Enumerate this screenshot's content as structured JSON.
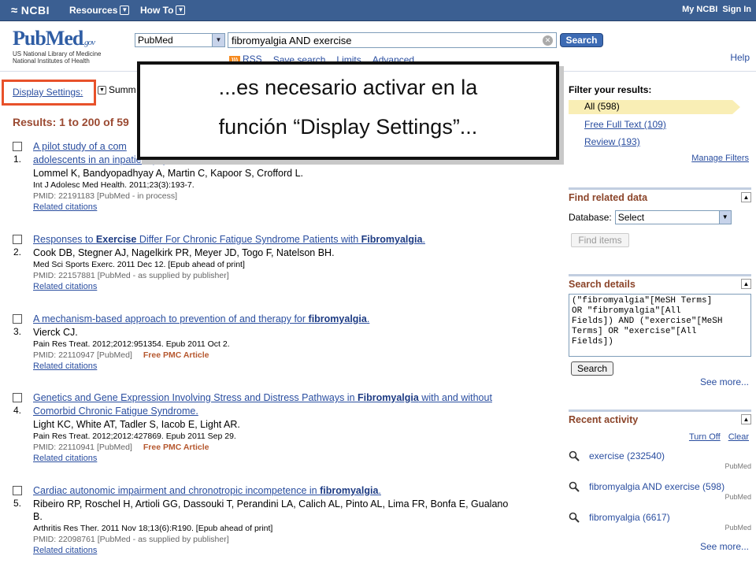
{
  "ncbi": {
    "logo": "NCBI",
    "menus": [
      "Resources",
      "How To"
    ],
    "right": [
      "My NCBI",
      "Sign In"
    ]
  },
  "header": {
    "logo_word": "PubMed",
    "logo_gov": ".gov",
    "logo_sub1": "US National Library of Medicine",
    "logo_sub2": "National Institutes of Health",
    "db_value": "PubMed",
    "search_value": "fibromyalgia AND exercise",
    "search_button": "Search",
    "links": [
      "RSS",
      "Save search",
      "Limits",
      "Advanced"
    ],
    "help": "Help"
  },
  "left": {
    "display_settings": "Display Settings:",
    "summary": "Summ",
    "results_count": "Results: 1 to 200 of 59"
  },
  "results": [
    {
      "num": "1.",
      "title_lines": [
        "A pilot study of a com",
        "adolescents in an inpatient psychiatric unit."
      ],
      "authors": "Lommel K, Bandyopadhyay A, Martin C, Kapoor S, Crofford L.",
      "journal": "Int J Adolesc Med Health. 2011;23(3):193-7.",
      "pmid": "PMID: 22191183 [PubMed - in process]",
      "pmc": "",
      "related": "Related citations"
    },
    {
      "num": "2.",
      "title_pre": "Responses to ",
      "title_b1": "Exercise",
      "title_mid": " Differ For Chronic Fatigue Syndrome Patients with ",
      "title_b2": "Fibromyalgia",
      "title_post": ".",
      "authors": "Cook DB, Stegner AJ, Nagelkirk PR, Meyer JD, Togo F, Natelson BH.",
      "journal": "Med Sci Sports Exerc. 2011 Dec 12. [Epub ahead of print]",
      "pmid": "PMID: 22157881 [PubMed - as supplied by publisher]",
      "related": "Related citations"
    },
    {
      "num": "3.",
      "title_pre": "A mechanism-based approach to prevention of and therapy for ",
      "title_b1": "fibromyalgia",
      "title_post": ".",
      "authors": "Vierck CJ.",
      "journal": "Pain Res Treat. 2012;2012:951354. Epub 2011 Oct 2.",
      "pmid": "PMID: 22110947 [PubMed]",
      "pmc": "Free PMC Article",
      "related": "Related citations"
    },
    {
      "num": "4.",
      "title_pre": "Genetics and Gene Expression Involving Stress and Distress Pathways in ",
      "title_b1": "Fibromyalgia",
      "title_mid": " with and without",
      "title_line2": "Comorbid Chronic Fatigue Syndrome.",
      "authors": "Light KC, White AT, Tadler S, Iacob E, Light AR.",
      "journal": "Pain Res Treat. 2012;2012:427869. Epub 2011 Sep 29.",
      "pmid": "PMID: 22110941 [PubMed]",
      "pmc": "Free PMC Article",
      "related": "Related citations"
    },
    {
      "num": "5.",
      "title_pre": "Cardiac autonomic impairment and chronotropic incompetence in ",
      "title_b1": "fibromyalgia",
      "title_post": ".",
      "authors": "Ribeiro RP, Roschel H, Artioli GG, Dassouki T, Perandini LA, Calich AL, Pinto AL, Lima FR, Bonfa E, Gualano",
      "authors2": "B.",
      "journal": "Arthritis Res Ther. 2011 Nov 18;13(6):R190. [Epub ahead of print]",
      "pmid": "PMID: 22098761 [PubMed - as supplied by publisher]",
      "related": "Related citations"
    }
  ],
  "filters": {
    "title": "Filter your results:",
    "all": "All (598)",
    "free_full_text": "Free Full Text (109)",
    "review": "Review (193)",
    "manage": "Manage Filters"
  },
  "related_data": {
    "title": "Find related data",
    "db_label": "Database:",
    "db_value": "Select",
    "button": "Find items"
  },
  "search_details": {
    "title": "Search details",
    "query": "(\"fibromyalgia\"[MeSH Terms]\nOR \"fibromyalgia\"[All\nFields]) AND (\"exercise\"[MeSH\nTerms] OR \"exercise\"[All\nFields])",
    "button": "Search",
    "see_more": "See more..."
  },
  "recent": {
    "title": "Recent activity",
    "turn_off": "Turn Off",
    "clear": "Clear",
    "items": [
      {
        "label": "exercise (232540)",
        "src": "PubMed"
      },
      {
        "label": "fibromyalgia AND exercise (598)",
        "src": "PubMed"
      },
      {
        "label": "fibromyalgia (6617)",
        "src": "PubMed"
      }
    ],
    "see_more": "See more..."
  },
  "callout": {
    "line1": "...es necesario activar en la",
    "line2": "función “Display Settings”..."
  }
}
